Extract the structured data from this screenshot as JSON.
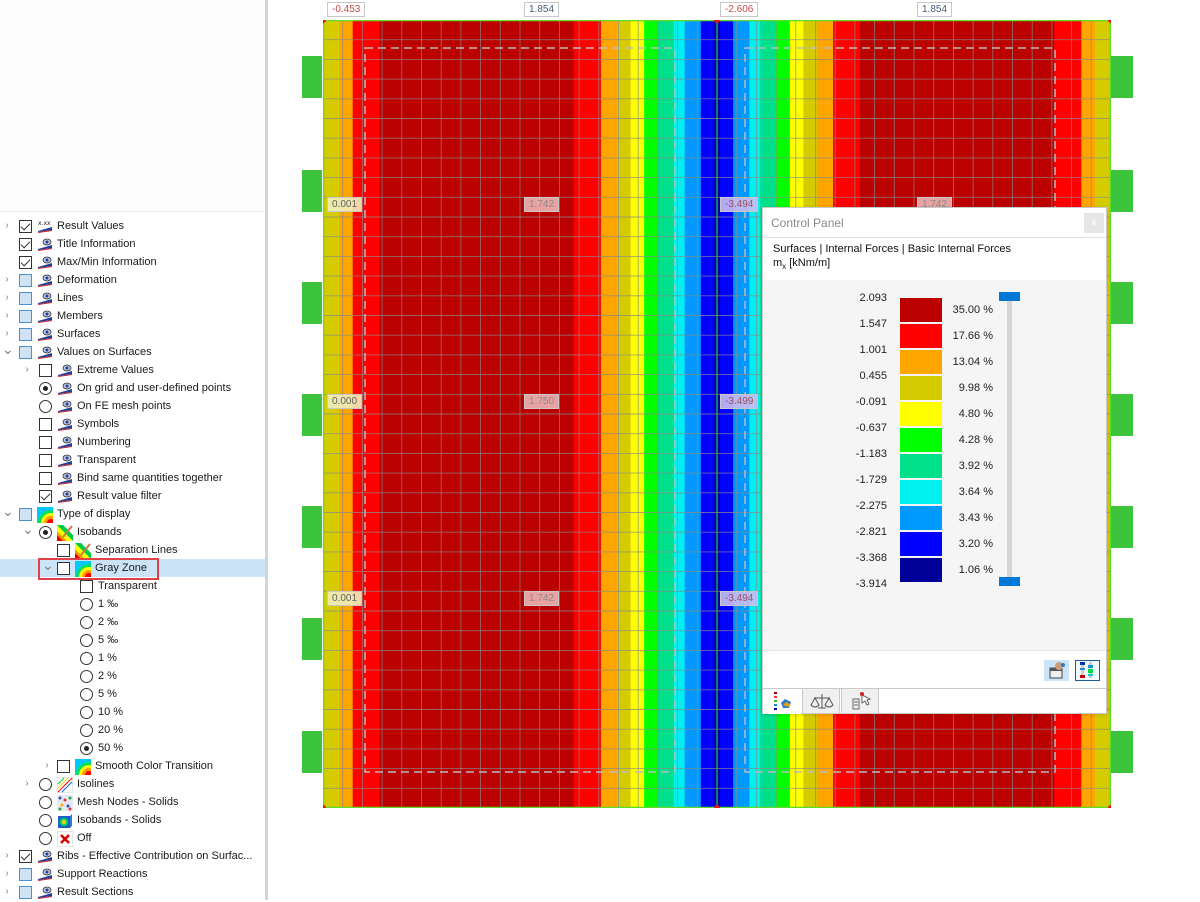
{
  "tree": [
    {
      "label": "Result Values",
      "level": 0,
      "chevron": "right",
      "control": "checkbox",
      "state": "checked",
      "icon": "result-values-icon"
    },
    {
      "label": "Title Information",
      "level": 0,
      "chevron": "",
      "control": "checkbox",
      "state": "checked",
      "icon": "eye-display-icon"
    },
    {
      "label": "Max/Min Information",
      "level": 0,
      "chevron": "",
      "control": "checkbox",
      "state": "checked",
      "icon": "eye-display-icon"
    },
    {
      "label": "Deformation",
      "level": 0,
      "chevron": "right",
      "control": "checkbox",
      "state": "partial",
      "icon": "eye-display-icon"
    },
    {
      "label": "Lines",
      "level": 0,
      "chevron": "right",
      "control": "checkbox",
      "state": "partial",
      "icon": "eye-display-icon"
    },
    {
      "label": "Members",
      "level": 0,
      "chevron": "right",
      "control": "checkbox",
      "state": "partial",
      "icon": "eye-display-icon"
    },
    {
      "label": "Surfaces",
      "level": 0,
      "chevron": "right",
      "control": "checkbox",
      "state": "partial",
      "icon": "eye-display-icon"
    },
    {
      "label": "Values on Surfaces",
      "level": 0,
      "chevron": "down",
      "control": "checkbox",
      "state": "partial",
      "icon": "eye-display-icon"
    },
    {
      "label": "Extreme Values",
      "level": 1,
      "chevron": "right",
      "control": "checkbox",
      "state": "unchecked",
      "icon": "eye-display-icon"
    },
    {
      "label": "On grid and user-defined points",
      "level": 1,
      "chevron": "",
      "control": "radio",
      "state": "checked",
      "icon": "eye-display-icon"
    },
    {
      "label": "On FE mesh points",
      "level": 1,
      "chevron": "",
      "control": "radio",
      "state": "unchecked",
      "icon": "eye-display-icon"
    },
    {
      "label": "Symbols",
      "level": 1,
      "chevron": "",
      "control": "checkbox",
      "state": "unchecked",
      "icon": "eye-display-icon"
    },
    {
      "label": "Numbering",
      "level": 1,
      "chevron": "",
      "control": "checkbox",
      "state": "unchecked",
      "icon": "eye-display-icon"
    },
    {
      "label": "Transparent",
      "level": 1,
      "chevron": "",
      "control": "checkbox",
      "state": "unchecked",
      "icon": "eye-display-icon"
    },
    {
      "label": "Bind same quantities together",
      "level": 1,
      "chevron": "",
      "control": "checkbox",
      "state": "unchecked",
      "icon": "eye-display-icon"
    },
    {
      "label": "Result value filter",
      "level": 1,
      "chevron": "",
      "control": "checkbox",
      "state": "checked",
      "icon": "eye-display-icon"
    },
    {
      "label": "Type of display",
      "level": 0,
      "chevron": "down",
      "control": "checkbox",
      "state": "partial",
      "icon": "contour-icon"
    },
    {
      "label": "Isobands",
      "level": 1,
      "chevron": "down",
      "control": "radio",
      "state": "checked",
      "icon": "isobands-icon"
    },
    {
      "label": "Separation Lines",
      "level": 2,
      "chevron": "",
      "control": "checkbox",
      "state": "unchecked",
      "icon": "isobands-icon"
    },
    {
      "label": "Gray Zone",
      "level": 2,
      "chevron": "down",
      "control": "checkbox",
      "state": "unchecked",
      "icon": "contour-icon",
      "selected": true
    },
    {
      "label": "Transparent",
      "level": 3,
      "chevron": "",
      "control": "checkbox",
      "state": "unchecked",
      "icon": ""
    },
    {
      "label": "1 ‰",
      "level": 3,
      "chevron": "",
      "control": "radio",
      "state": "unchecked",
      "icon": ""
    },
    {
      "label": "2 ‰",
      "level": 3,
      "chevron": "",
      "control": "radio",
      "state": "unchecked",
      "icon": ""
    },
    {
      "label": "5 ‰",
      "level": 3,
      "chevron": "",
      "control": "radio",
      "state": "unchecked",
      "icon": ""
    },
    {
      "label": "1 %",
      "level": 3,
      "chevron": "",
      "control": "radio",
      "state": "unchecked",
      "icon": ""
    },
    {
      "label": "2 %",
      "level": 3,
      "chevron": "",
      "control": "radio",
      "state": "unchecked",
      "icon": ""
    },
    {
      "label": "5 %",
      "level": 3,
      "chevron": "",
      "control": "radio",
      "state": "unchecked",
      "icon": ""
    },
    {
      "label": "10 %",
      "level": 3,
      "chevron": "",
      "control": "radio",
      "state": "unchecked",
      "icon": ""
    },
    {
      "label": "20 %",
      "level": 3,
      "chevron": "",
      "control": "radio",
      "state": "unchecked",
      "icon": ""
    },
    {
      "label": "50 %",
      "level": 3,
      "chevron": "",
      "control": "radio",
      "state": "checked",
      "icon": ""
    },
    {
      "label": "Smooth Color Transition",
      "level": 2,
      "chevron": "right",
      "control": "checkbox",
      "state": "unchecked",
      "icon": "contour-icon"
    },
    {
      "label": "Isolines",
      "level": 1,
      "chevron": "right",
      "control": "radio",
      "state": "unchecked",
      "icon": "isolines-icon"
    },
    {
      "label": "Mesh Nodes - Solids",
      "level": 1,
      "chevron": "",
      "control": "radio",
      "state": "unchecked",
      "icon": "mesh-nodes-icon"
    },
    {
      "label": "Isobands - Solids",
      "level": 1,
      "chevron": "",
      "control": "radio",
      "state": "unchecked",
      "icon": "solids-icon"
    },
    {
      "label": "Off",
      "level": 1,
      "chevron": "",
      "control": "radio",
      "state": "unchecked",
      "icon": "off-x-icon"
    },
    {
      "label": "Ribs - Effective Contribution on Surfac...",
      "level": 0,
      "chevron": "right",
      "control": "checkbox",
      "state": "checked",
      "icon": "eye-display-icon"
    },
    {
      "label": "Support Reactions",
      "level": 0,
      "chevron": "right",
      "control": "checkbox",
      "state": "partial",
      "icon": "eye-display-icon"
    },
    {
      "label": "Result Sections",
      "level": 0,
      "chevron": "right",
      "control": "checkbox",
      "state": "partial",
      "icon": "eye-display-icon"
    }
  ],
  "model": {
    "band_sequence": [
      "#d4cc00",
      "#ffa500",
      "#ff0000",
      "#bb0000",
      "#bb0000",
      "#ff0000",
      "#ffa500",
      "#d4cc00",
      "#ffff00",
      "#00ff00",
      "#00e08a",
      "#00f0f0",
      "#0099ff",
      "#0000ff",
      "#000099",
      "#0000ff",
      "#0099ff",
      "#00f0f0",
      "#00e08a",
      "#00ff00",
      "#ffff00",
      "#d4cc00",
      "#ffa500",
      "#ff0000",
      "#bb0000",
      "#bb0000",
      "#ff0000",
      "#ffa500",
      "#d4cc00"
    ],
    "band_weights": [
      0.3,
      0.25,
      0.5,
      1.8,
      1.8,
      0.5,
      0.3,
      0.25,
      0.25,
      0.25,
      0.3,
      0.2,
      0.3,
      0.25,
      0.1,
      0.25,
      0.3,
      0.2,
      0.3,
      0.25,
      0.25,
      0.25,
      0.3,
      0.5,
      1.8,
      1.8,
      0.5,
      0.25,
      0.3
    ],
    "support_color": "#3cc43c",
    "labels": [
      {
        "text": "-0.453",
        "kind": "neg-top",
        "col": 0,
        "row": 0
      },
      {
        "text": "1.854",
        "kind": "pos-top",
        "col": 1,
        "row": 0
      },
      {
        "text": "-2.606",
        "kind": "neg-top",
        "col": 2,
        "row": 0
      },
      {
        "text": "1.854",
        "kind": "pos-top",
        "col": 3,
        "row": 0
      },
      {
        "text": "0.001",
        "kind": "yellow",
        "col": 0,
        "row": 1
      },
      {
        "text": "1.742",
        "kind": "red",
        "col": 1,
        "row": 1
      },
      {
        "text": "-3.494",
        "kind": "blue",
        "col": 2,
        "row": 1
      },
      {
        "text": "1.742",
        "kind": "red",
        "col": 3,
        "row": 1
      },
      {
        "text": "0.000",
        "kind": "yellow",
        "col": 0,
        "row": 2
      },
      {
        "text": "1.750",
        "kind": "red",
        "col": 1,
        "row": 2
      },
      {
        "text": "-3.499",
        "kind": "blue",
        "col": 2,
        "row": 2
      },
      {
        "text": "0.001",
        "kind": "yellow",
        "col": 0,
        "row": 3
      },
      {
        "text": "1.742",
        "kind": "red",
        "col": 1,
        "row": 3
      },
      {
        "text": "-3.494",
        "kind": "blue",
        "col": 2,
        "row": 3
      }
    ]
  },
  "control_panel": {
    "title": "Control Panel",
    "close_label": "x",
    "path": "Surfaces | Internal Forces | Basic Internal Forces",
    "quantity_main": "m",
    "quantity_sub": "x",
    "quantity_unit": " [kNm/m]",
    "legend_values": [
      "2.093",
      "1.547",
      "1.001",
      "0.455",
      "-0.091",
      "-0.637",
      "-1.183",
      "-1.729",
      "-2.275",
      "-2.821",
      "-3.368",
      "-3.914"
    ],
    "legend_bands": [
      {
        "color": "#bb0000",
        "percent": "35.00 %"
      },
      {
        "color": "#ff0000",
        "percent": "17.66 %"
      },
      {
        "color": "#ffa500",
        "percent": "13.04 %"
      },
      {
        "color": "#d4cc00",
        "percent": "9.98 %"
      },
      {
        "color": "#ffff00",
        "percent": "4.80 %"
      },
      {
        "color": "#00ff00",
        "percent": "4.28 %"
      },
      {
        "color": "#00e08a",
        "percent": "3.92 %"
      },
      {
        "color": "#00f0f0",
        "percent": "3.64 %"
      },
      {
        "color": "#0099ff",
        "percent": "3.43 %"
      },
      {
        "color": "#0000ff",
        "percent": "3.20 %"
      },
      {
        "color": "#000099",
        "percent": "1.06 %"
      }
    ]
  }
}
